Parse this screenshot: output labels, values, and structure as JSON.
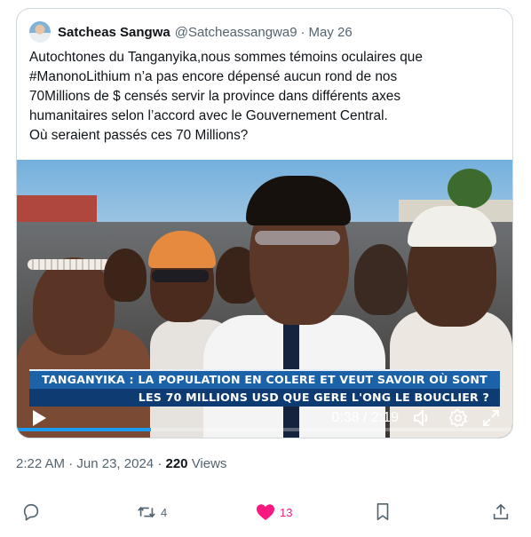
{
  "quoted": {
    "display_name": "Satcheas Sangwa",
    "handle": "@Satcheassangwa9",
    "separator": "·",
    "date": "May 26",
    "text_lines": [
      "Autochtones du Tanganyika,nous sommes témoins oculaires que",
      "#ManonoLithium n’a pas encore dépensé aucun rond de nos",
      "70Millions de $ censés servir la province dans différents axes",
      "humanitaires selon l’accord avec le Gouvernement Central.",
      "Où seraient passés ces 70 Millions?"
    ],
    "video": {
      "banner_line1": "TANGANYIKA : LA POPULATION EN COLERE ET VEUT SAVOIR OÙ SONT",
      "banner_line2": "LES 70 MILLIONS USD QUE GERE L'ONG LE BOUCLIER ?",
      "time": "0:38 / 2:19",
      "progress": 0.27
    }
  },
  "meta": {
    "time": "2:22 AM",
    "dot": "·",
    "date": "Jun 23, 2024",
    "views_count": "220",
    "views_label": "Views"
  },
  "actions": {
    "retweets": "4",
    "likes": "13",
    "like_color": "#f91880"
  }
}
